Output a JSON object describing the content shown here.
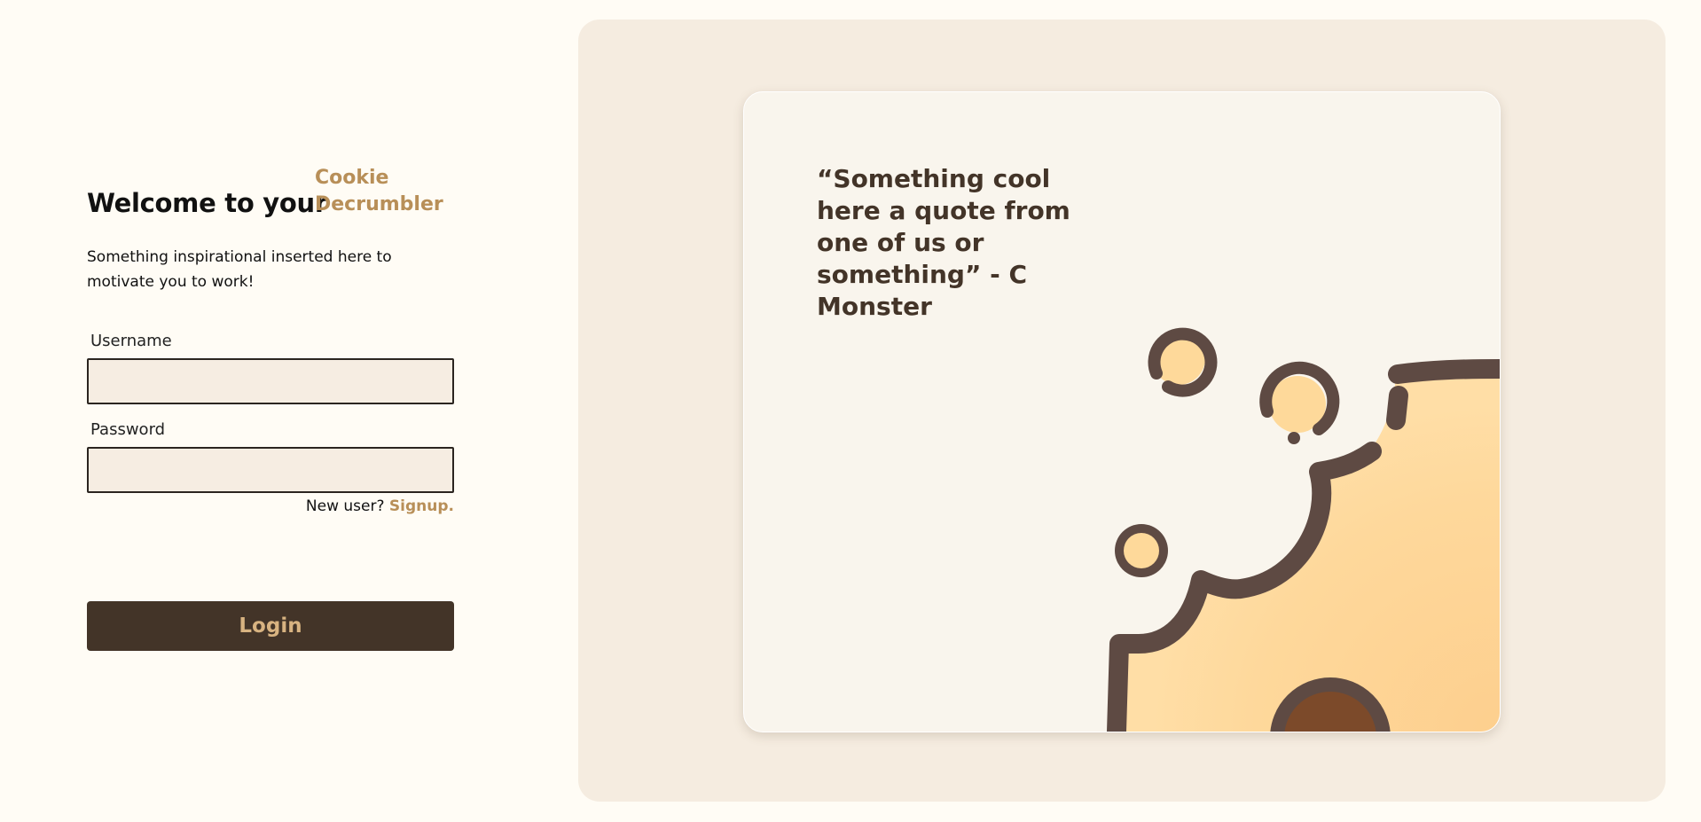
{
  "login": {
    "welcome": "Welcome to your",
    "brand": "Cookie Decrumbler",
    "tagline": "Something inspirational inserted here to motivate you to work!",
    "username_label": "Username",
    "username_value": "",
    "password_label": "Password",
    "password_value": "",
    "signup_prompt": "New user?",
    "signup_link": "Signup.",
    "login_button": "Login"
  },
  "showcase": {
    "quote": "“Something cool here a quote from one of us or something” - C Monster",
    "illustration_icon": "bitten-cookie-icon"
  },
  "colors": {
    "page_background": "#fffcf5",
    "panel_background": "#f5ece0",
    "card_background": "#f9f5ed",
    "accent": "#b88f58",
    "button_background": "#433428",
    "button_text": "#d8b381",
    "cookie_fill": "#fed99a",
    "cookie_outline": "#5e4a43",
    "input_background": "#f6ede2"
  }
}
